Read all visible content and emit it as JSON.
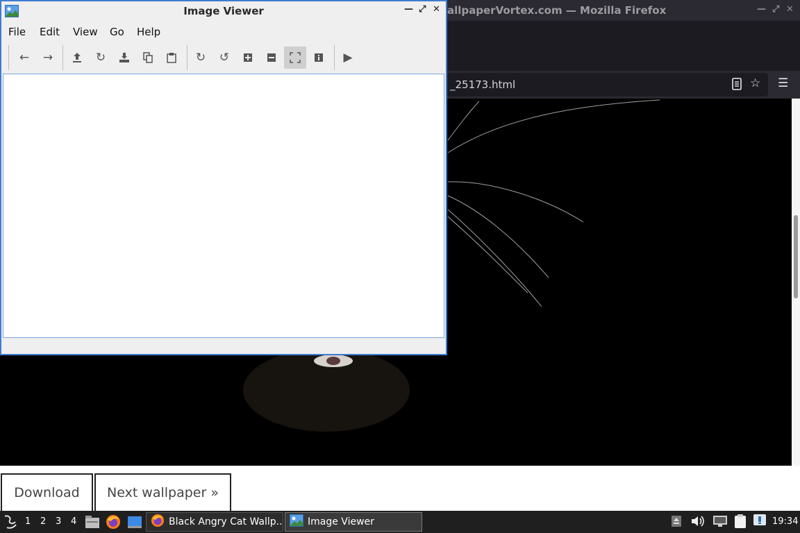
{
  "firefox": {
    "title": "allpaperVortex.com — Mozilla Firefox",
    "url": "_25173.html",
    "buttons": {
      "download": "Download",
      "next": "Next wallpaper »"
    }
  },
  "viewer": {
    "title": "Image Viewer",
    "menu": [
      "File",
      "Edit",
      "View",
      "Go",
      "Help"
    ],
    "toolbar_icons": [
      "arrow-left-icon",
      "arrow-right-icon",
      "upload-icon",
      "reload-icon",
      "save-icon",
      "copy-icon",
      "paste-icon",
      "rotate-cw-icon",
      "rotate-ccw-icon",
      "zoom-in-icon",
      "zoom-out-icon",
      "fit-icon",
      "info-icon",
      "slideshow-icon"
    ]
  },
  "taskbar": {
    "desktops": [
      "1",
      "2",
      "3",
      "4"
    ],
    "tasks": [
      {
        "label": "Black Angry Cat Wallp...",
        "icon": "firefox-icon"
      },
      {
        "label": "Image Viewer",
        "icon": "image-viewer-icon"
      }
    ],
    "clock": "19:34"
  },
  "colors": {
    "accent": "#3d7bd0",
    "taskbar": "#1f1f1f",
    "firefox_dark": "#2b2a33"
  }
}
